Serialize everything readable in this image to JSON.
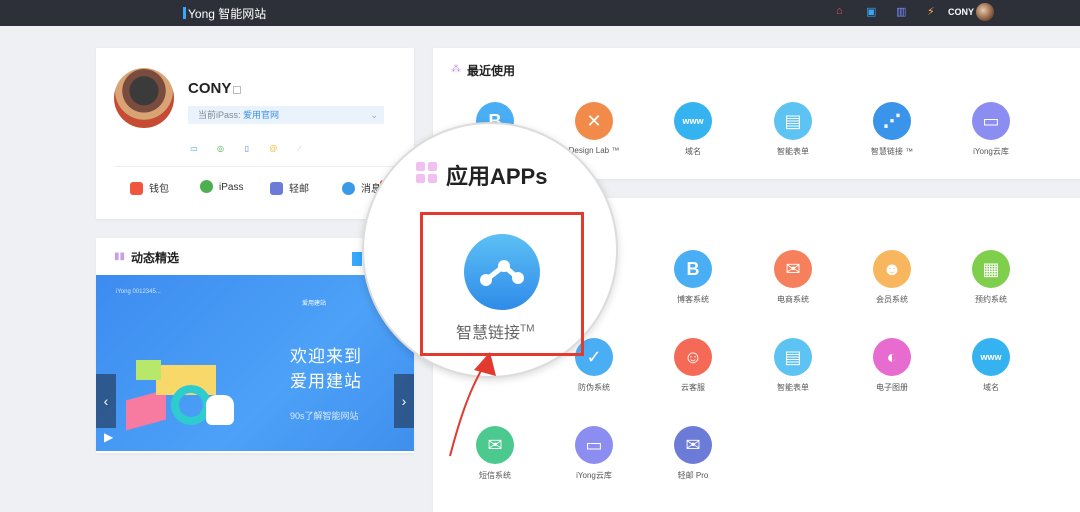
{
  "header": {
    "brand": "Yong 智能网站",
    "user": "CONY",
    "icons": [
      "home-icon",
      "layout-icon",
      "building-icon",
      "lightning-icon"
    ]
  },
  "profile": {
    "name": "CONY",
    "ipass_label": "当前iPass: ",
    "ipass_value": "爱用官网",
    "actions": [
      {
        "label": "钱包",
        "color": "#f0553e"
      },
      {
        "label": "iPass",
        "color": "#4caf50"
      },
      {
        "label": "轻邮",
        "color": "#6c7bd8"
      },
      {
        "label": "消息",
        "color": "#3a9ae8"
      }
    ],
    "message_badge": "99"
  },
  "feed": {
    "title": "动态精选",
    "banner": {
      "headline1": "欢迎来到",
      "headline2": "爱用建站",
      "subline": "90s了解智能网站",
      "logo": "爱用建站",
      "user": "iYong 0012345..."
    }
  },
  "recent": {
    "title": "最近使用",
    "items": [
      {
        "label": "",
        "glyph": "B",
        "color": "#4aaef5"
      },
      {
        "label": "Design Lab ™",
        "glyph": "✕",
        "color": "#f28a4a"
      },
      {
        "label": "域名",
        "glyph": "www",
        "color": "#35b3f0"
      },
      {
        "label": "智能表单",
        "glyph": "▤",
        "color": "#5cc3f3"
      },
      {
        "label": "智慧链接 ™",
        "glyph": "⋰",
        "color": "#3a94ea"
      },
      {
        "label": "iYong云库",
        "glyph": "▭",
        "color": "#8c8df0"
      }
    ]
  },
  "apps": {
    "title": "应用APPs",
    "row1": [
      {
        "label": "博客系统",
        "glyph": "B",
        "color": "#4aaef5"
      },
      {
        "label": "电商系统",
        "glyph": "✉",
        "color": "#f67f5c"
      },
      {
        "label": "会员系统",
        "glyph": "☻",
        "color": "#f8b75e"
      },
      {
        "label": "预约系统",
        "glyph": "▦",
        "color": "#7fce4c"
      }
    ],
    "row2": [
      {
        "label": "防伪系统",
        "glyph": "✓",
        "color": "#4aaef5"
      },
      {
        "label": "云客服",
        "glyph": "☺",
        "color": "#f56a56"
      },
      {
        "label": "智能表单",
        "glyph": "▤",
        "color": "#5cc3f3"
      },
      {
        "label": "电子图册",
        "glyph": "◐",
        "color": "#e86bd0"
      },
      {
        "label": "域名",
        "glyph": "www",
        "color": "#35b3f0"
      }
    ],
    "row3": [
      {
        "label": "短信系统",
        "glyph": "✉",
        "color": "#4cc98e"
      },
      {
        "label": "iYong云库",
        "glyph": "▭",
        "color": "#8c8df0"
      },
      {
        "label": "轻邮 Pro",
        "glyph": "✉",
        "color": "#6c7bd8"
      }
    ]
  },
  "magnifier": {
    "title": "应用APPs",
    "highlight_label": "智慧链接",
    "highlight_tm": "TM"
  }
}
